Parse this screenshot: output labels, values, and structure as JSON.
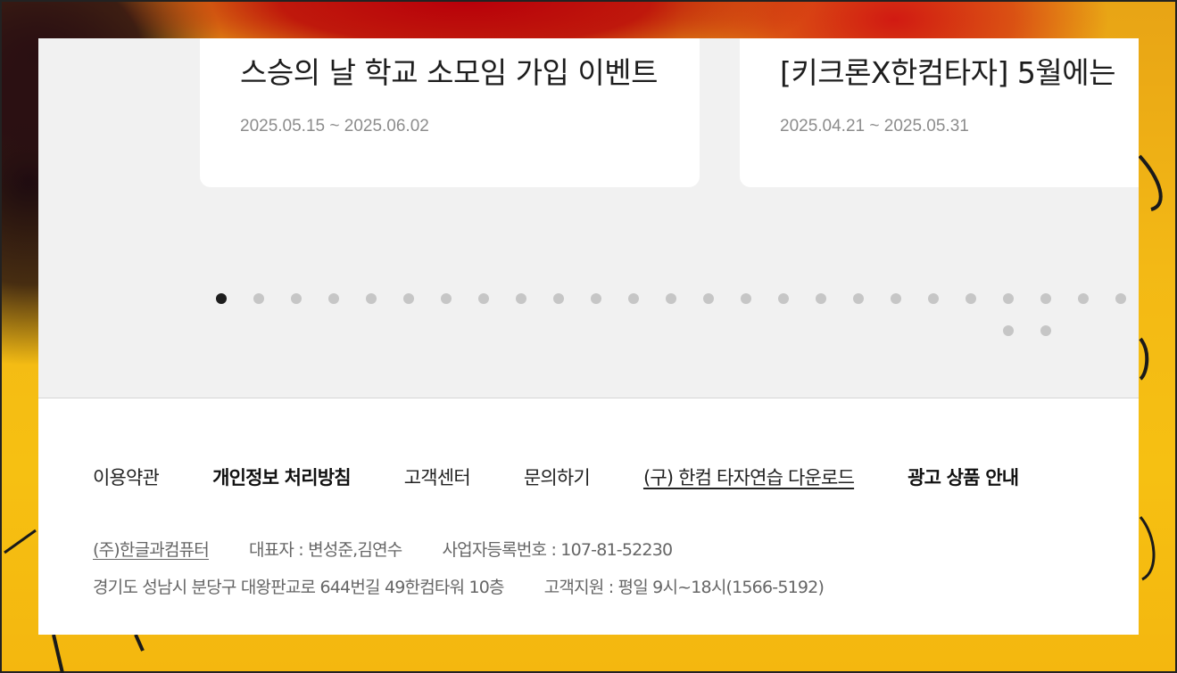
{
  "cards": [
    {
      "title": "스승의 날 학교 소모임 가입 이벤트",
      "date": "2025.05.15 ~ 2025.06.02"
    },
    {
      "title": "[키크론X한컴타자] 5월에는",
      "date": "2025.04.21 ~ 2025.05.31"
    }
  ],
  "pagination": {
    "total": 27,
    "active": 1
  },
  "footer": {
    "links": [
      {
        "label": "이용약관"
      },
      {
        "label": "개인정보 처리방침"
      },
      {
        "label": "고객센터"
      },
      {
        "label": "문의하기"
      },
      {
        "label": "(구) 한컴 타자연습 다운로드"
      },
      {
        "label": "광고 상품 안내"
      }
    ],
    "company": {
      "name": "(주)한글과컴퓨터",
      "ceo": "대표자 : 변성준,김연수",
      "business_number": "사업자등록번호 : 107-81-52230",
      "address": "경기도 성남시 분당구 대왕판교로 644번길 49한컴타워 10층",
      "support": "고객지원 : 평일 9시~18시(1566-5192)"
    }
  },
  "colors": {
    "wallpaper_yellow": "#f6c012",
    "wallpaper_red": "#b8000a",
    "page_gray": "#f1f1f1",
    "dot_active": "#1e1e1e",
    "dot_inactive": "#c6c6c6"
  }
}
